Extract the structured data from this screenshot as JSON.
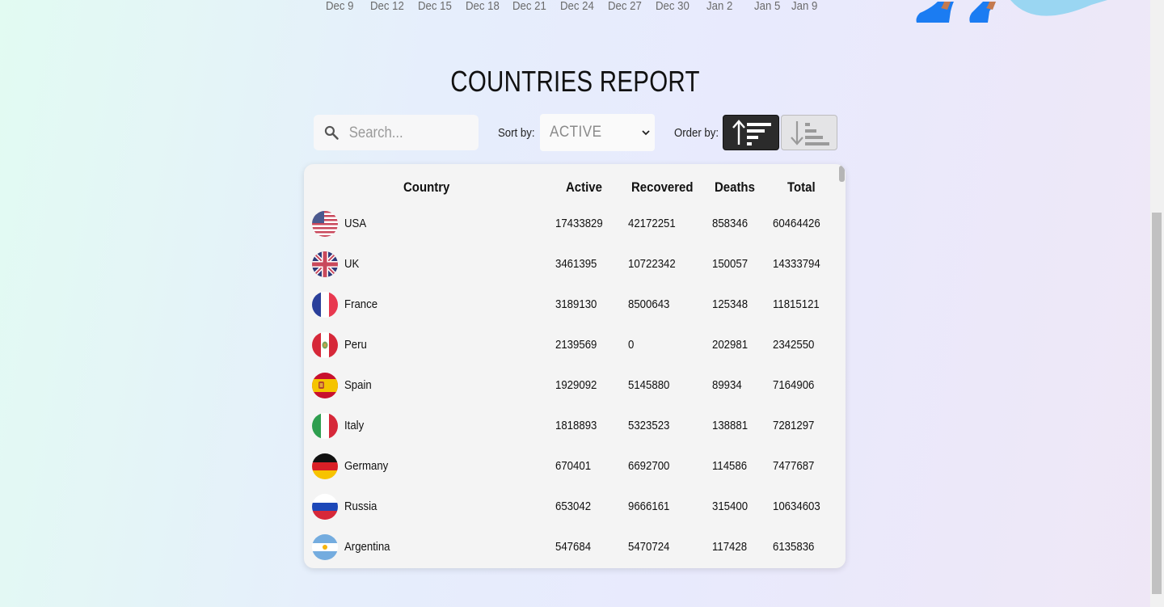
{
  "chart_axis": {
    "ticks": [
      "Dec 9",
      "Dec 12",
      "Dec 15",
      "Dec 18",
      "Dec 21",
      "Dec 24",
      "Dec 27",
      "Dec 30",
      "Jan 2",
      "Jan 5",
      "Jan 9"
    ]
  },
  "report": {
    "title": "COUNTRIES REPORT",
    "search_placeholder": "Search...",
    "sort_label": "Sort by:",
    "sort_selected": "ACTIVE",
    "order_label": "Order by:",
    "order_active": "descending",
    "columns": [
      "Country",
      "Active",
      "Recovered",
      "Deaths",
      "Total"
    ],
    "rows": [
      {
        "country": "USA",
        "active": "17433829",
        "recovered": "42172251",
        "deaths": "858346",
        "total": "60464426",
        "flag": "flag-usa-icon"
      },
      {
        "country": "UK",
        "active": "3461395",
        "recovered": "10722342",
        "deaths": "150057",
        "total": "14333794",
        "flag": "flag-uk-icon"
      },
      {
        "country": "France",
        "active": "3189130",
        "recovered": "8500643",
        "deaths": "125348",
        "total": "11815121",
        "flag": "flag-france-icon"
      },
      {
        "country": "Peru",
        "active": "2139569",
        "recovered": "0",
        "deaths": "202981",
        "total": "2342550",
        "flag": "flag-peru-icon"
      },
      {
        "country": "Spain",
        "active": "1929092",
        "recovered": "5145880",
        "deaths": "89934",
        "total": "7164906",
        "flag": "flag-spain-icon"
      },
      {
        "country": "Italy",
        "active": "1818893",
        "recovered": "5323523",
        "deaths": "138881",
        "total": "7281297",
        "flag": "flag-italy-icon"
      },
      {
        "country": "Germany",
        "active": "670401",
        "recovered": "6692700",
        "deaths": "114586",
        "total": "7477687",
        "flag": "flag-germany-icon"
      },
      {
        "country": "Russia",
        "active": "653042",
        "recovered": "9666161",
        "deaths": "315400",
        "total": "10634603",
        "flag": "flag-russia-icon"
      },
      {
        "country": "Argentina",
        "active": "547684",
        "recovered": "5470724",
        "deaths": "117428",
        "total": "6135836",
        "flag": "flag-argentina-icon"
      }
    ]
  },
  "colors": {
    "accent_blue": "#1b7cf2",
    "light_blue": "#9ad6f2",
    "button_dark": "#2b2b2b"
  }
}
